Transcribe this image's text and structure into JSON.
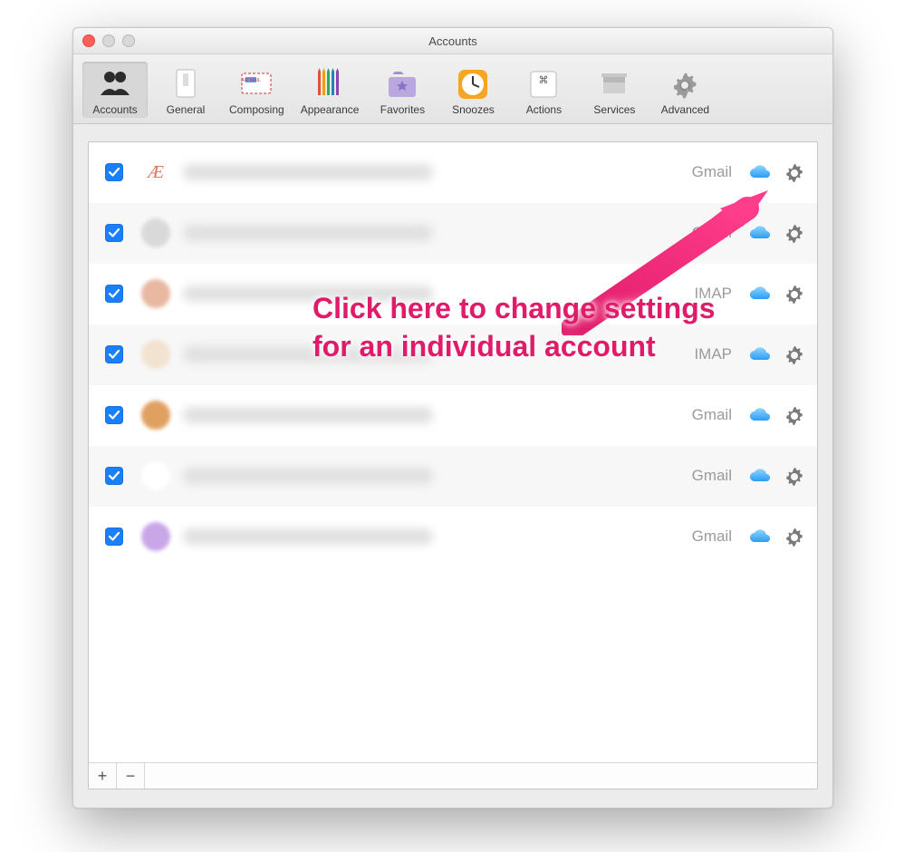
{
  "window": {
    "title": "Accounts"
  },
  "toolbar": [
    {
      "id": "accounts",
      "label": "Accounts",
      "selected": true
    },
    {
      "id": "general",
      "label": "General",
      "selected": false
    },
    {
      "id": "composing",
      "label": "Composing",
      "selected": false
    },
    {
      "id": "appearance",
      "label": "Appearance",
      "selected": false
    },
    {
      "id": "favorites",
      "label": "Favorites",
      "selected": false
    },
    {
      "id": "snoozes",
      "label": "Snoozes",
      "selected": false
    },
    {
      "id": "actions",
      "label": "Actions",
      "selected": false
    },
    {
      "id": "services",
      "label": "Services",
      "selected": false
    },
    {
      "id": "advanced",
      "label": "Advanced",
      "selected": false
    }
  ],
  "accounts": [
    {
      "checked": true,
      "type": "Gmail",
      "avatarColor": "#ffffff",
      "ae": true
    },
    {
      "checked": true,
      "type": "Gmail",
      "avatarColor": "#d9d9d9"
    },
    {
      "checked": true,
      "type": "IMAP",
      "avatarColor": "#e8b8a0"
    },
    {
      "checked": true,
      "type": "IMAP",
      "avatarColor": "#f2e2d0"
    },
    {
      "checked": true,
      "type": "Gmail",
      "avatarColor": "#e0a060"
    },
    {
      "checked": true,
      "type": "Gmail",
      "avatarColor": "#ffffff"
    },
    {
      "checked": true,
      "type": "Gmail",
      "avatarColor": "#c9a6e8"
    }
  ],
  "annotation": {
    "text": "Click here to change settings for an individual account"
  },
  "footer": {
    "add": "+",
    "remove": "−"
  }
}
